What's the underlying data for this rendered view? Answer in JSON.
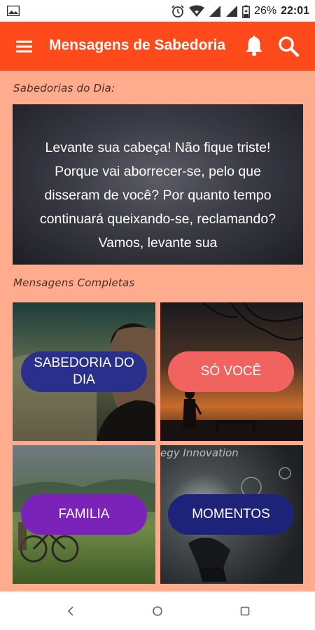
{
  "status_bar": {
    "battery": "26%",
    "time": "22:01"
  },
  "app_bar": {
    "title": "Mensagens de Sabedoria"
  },
  "daily": {
    "label": "Sabedorias do Dia:",
    "quote": "Levante sua cabeça! Não fique triste! Porque vai aborrecer-se, pelo que disseram de você? Por quanto tempo continuará queixando-se, reclamando? Vamos, levante sua"
  },
  "complete": {
    "label": "Mensagens Completas",
    "tiles": [
      {
        "label": "SABEDORIA DO DIA",
        "button_color": "#2A2F8C"
      },
      {
        "label": "SÓ VOCÊ",
        "button_color": "#F0635F"
      },
      {
        "label": "FAMILIA",
        "button_color": "#7B22B8"
      },
      {
        "label": "MOMENTOS",
        "button_color": "#1E237A"
      }
    ],
    "chalkboard_text": "egy Innovation"
  },
  "colors": {
    "accent": "#FF4A1C",
    "background": "#FFAC8E"
  }
}
